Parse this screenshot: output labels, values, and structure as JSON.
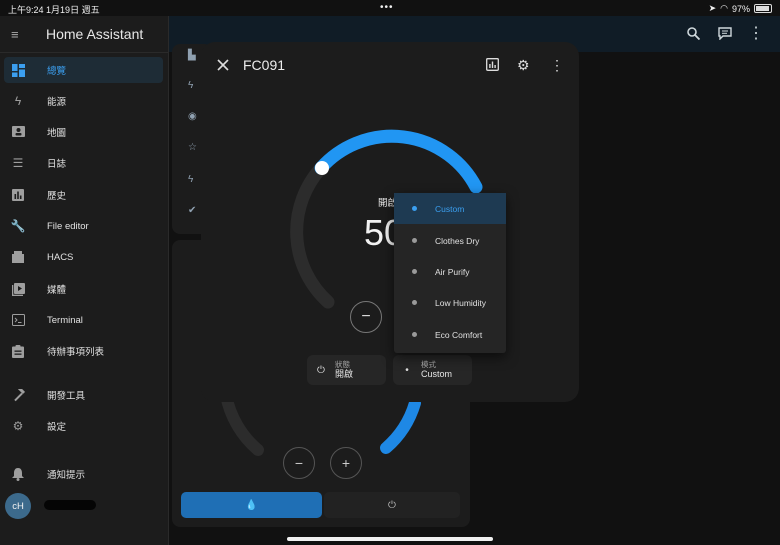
{
  "status_bar": {
    "time": "上午9:24",
    "date": "1月19日 週五",
    "dots": "•••",
    "battery": "97%"
  },
  "sidebar": {
    "title": "Home Assistant",
    "items": [
      {
        "label": "總覽",
        "icon": "dashboard-icon",
        "active": true
      },
      {
        "label": "能源",
        "icon": "lightning-icon"
      },
      {
        "label": "地圖",
        "icon": "map-person-icon"
      },
      {
        "label": "日誌",
        "icon": "list-icon"
      },
      {
        "label": "歷史",
        "icon": "chart-icon"
      },
      {
        "label": "File editor",
        "icon": "wrench-icon"
      },
      {
        "label": "HACS",
        "icon": "hacs-icon"
      },
      {
        "label": "媒體",
        "icon": "media-icon"
      },
      {
        "label": "Terminal",
        "icon": "terminal-icon"
      },
      {
        "label": "待辦事項列表",
        "icon": "clipboard-icon"
      },
      {
        "label": "開發工具",
        "icon": "hammer-icon"
      },
      {
        "label": "設定",
        "icon": "gear-icon"
      },
      {
        "label": "通知提示",
        "icon": "bell-icon"
      }
    ],
    "user_initials": "cH"
  },
  "dialog": {
    "title": "FC091",
    "state_label": "開啟",
    "value": "50",
    "level_percent": 50,
    "chips": [
      {
        "label": "狀態",
        "value": "開啟"
      },
      {
        "label": "模式",
        "value": "Custom"
      }
    ]
  },
  "dropdown": {
    "options": [
      "Custom",
      "Clothes Dry",
      "Air Purify",
      "Low Humidity",
      "Eco Comfort"
    ],
    "selected": "Custom"
  },
  "colors": {
    "accent": "#2196f3",
    "sidebar_active_bg": "#1e2c36",
    "background": "#111111"
  }
}
